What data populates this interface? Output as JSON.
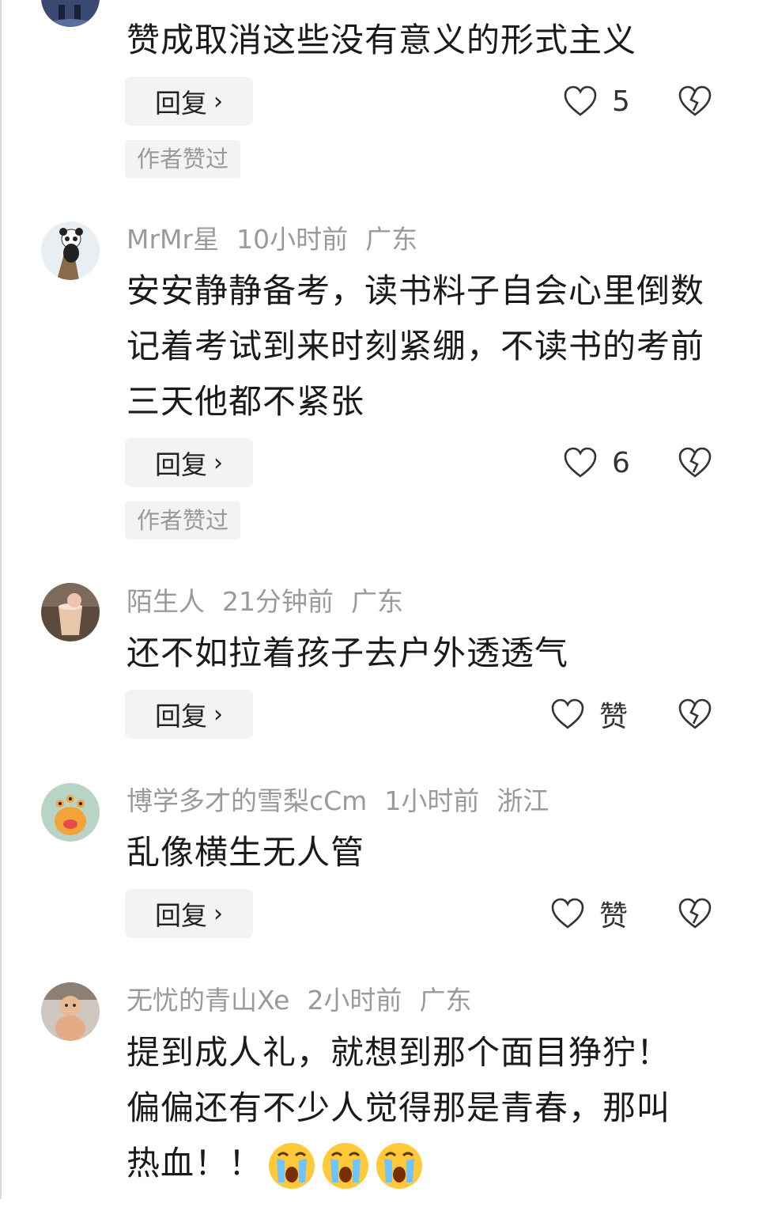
{
  "actions": {
    "reply_label": "回复",
    "reply_chevron": "›",
    "author_liked_badge": "作者赞过",
    "like_word": "赞"
  },
  "comments": [
    {
      "avatar_icon": "avatar-figure-icon",
      "content": "赞成取消这些没有意义的形式主义",
      "likes": "5",
      "author_liked": true
    },
    {
      "username": "MrMr星",
      "time": "10小时前",
      "location": "广东",
      "avatar_icon": "avatar-panda-icon",
      "content": "安安静静备考，读书料子自会心里倒数记着考试到来时刻紧绷，不读书的考前三天他都不紧张",
      "likes": "6",
      "author_liked": true
    },
    {
      "username": "陌生人",
      "time": "21分钟前",
      "location": "广东",
      "avatar_icon": "avatar-cup-icon",
      "content": "还不如拉着孩子去户外透透气",
      "likes": "赞",
      "author_liked": false
    },
    {
      "username": "博学多才的雪梨cCm",
      "time": "1小时前",
      "location": "浙江",
      "avatar_icon": "avatar-monster-icon",
      "content": "乱像横生无人管",
      "likes": "赞",
      "author_liked": false
    },
    {
      "username": "无忧的青山Xe",
      "time": "2小时前",
      "location": "广东",
      "avatar_icon": "avatar-baby-icon",
      "content": "提到成人礼，就想到那个面目狰狞！偏偏还有不少人觉得那是青春，那叫热血！！",
      "emojis": [
        "crying-emoji-icon",
        "crying-emoji-icon",
        "crying-emoji-icon"
      ]
    }
  ],
  "colors": {
    "meta_gray": "#9a9a9a",
    "button_bg": "#f3f3f3",
    "text": "#1a1a1a"
  }
}
